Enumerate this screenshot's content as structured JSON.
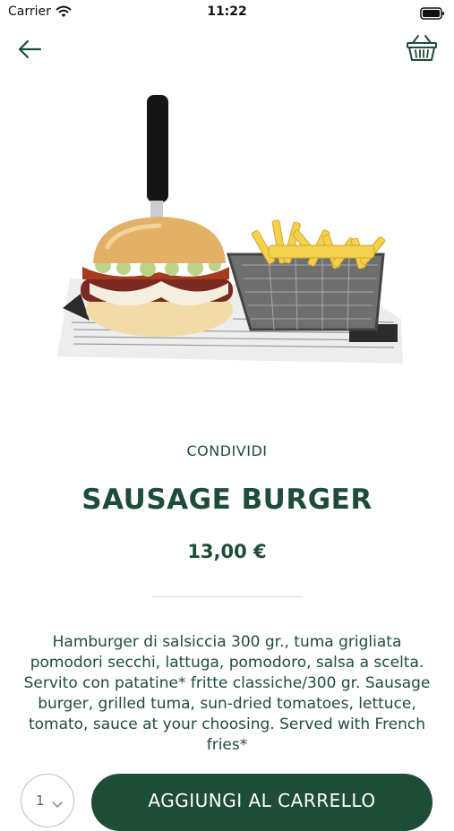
{
  "status": {
    "carrier": "Carrier",
    "time": "11:22"
  },
  "nav": {
    "back_icon": "back-arrow-icon",
    "cart_icon": "basket-icon"
  },
  "product": {
    "share_label": "CONDIVIDI",
    "name": "SAUSAGE BURGER",
    "price": "13,00 €",
    "description": "Hamburger di salsiccia 300 gr., tuma grigliata pomodori secchi, lattuga, pomodoro, salsa a scelta. Servito con patatine* fritte classiche/300 gr. Sausage burger, grilled tuma, sun-dried tomatoes, lettuce, tomato, sauce at your choosing. Served with French fries*"
  },
  "cart": {
    "quantity": "1",
    "add_label": "AGGIUNGI AL CARRELLO"
  },
  "colors": {
    "brand": "#1e4d37",
    "background": "#ffffff"
  }
}
